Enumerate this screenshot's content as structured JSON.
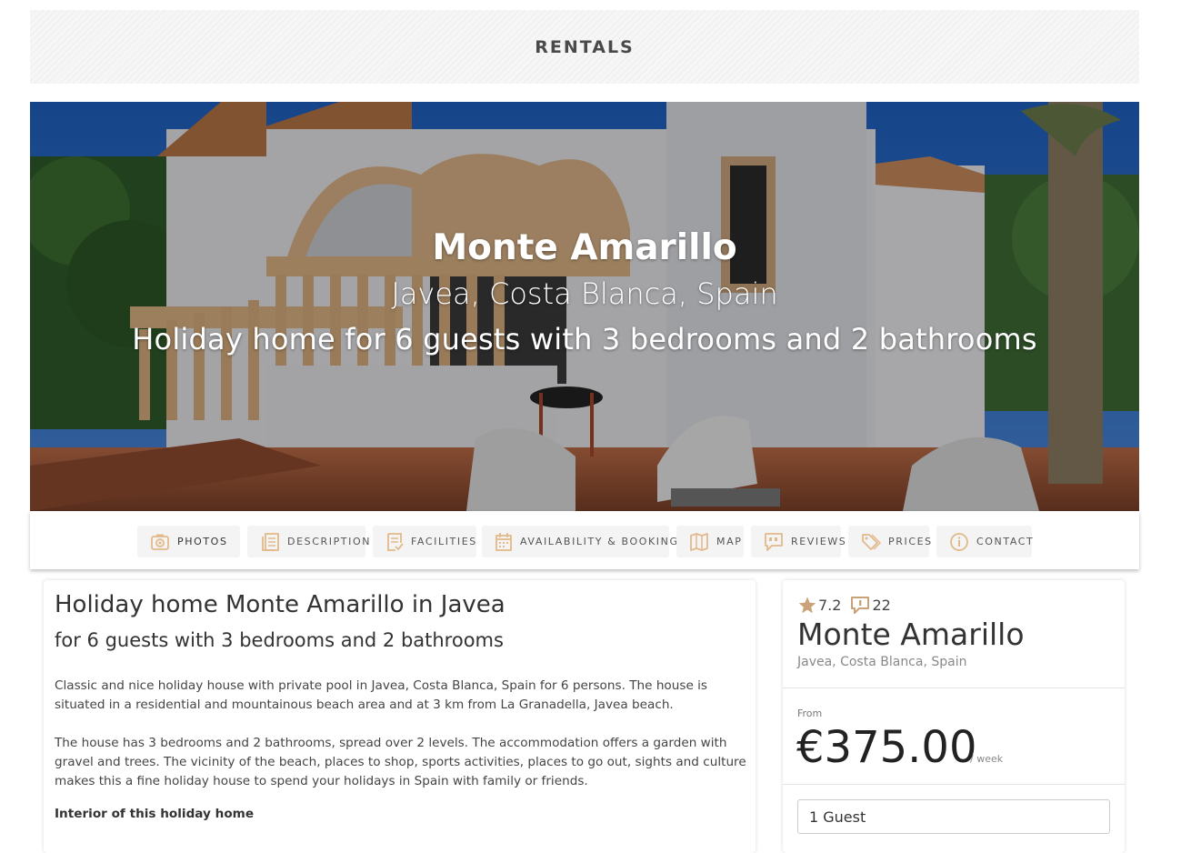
{
  "header": {
    "title": "RENTALS"
  },
  "hero": {
    "name": "Monte Amarillo",
    "location": "Javea, Costa Blanca, Spain",
    "subtitle": "Holiday home for 6 guests with 3 bedrooms and 2 bathrooms"
  },
  "tabs": [
    {
      "label": "PHOTOS",
      "icon": "camera-icon"
    },
    {
      "label": "DESCRIPTION",
      "icon": "document-icon"
    },
    {
      "label": "FACILITIES",
      "icon": "checklist-icon"
    },
    {
      "label": "AVAILABILITY & BOOKING",
      "icon": "calendar-icon"
    },
    {
      "label": "MAP",
      "icon": "map-icon"
    },
    {
      "label": "REVIEWS",
      "icon": "quote-bubble-icon"
    },
    {
      "label": "PRICES",
      "icon": "tags-icon"
    },
    {
      "label": "CONTACT",
      "icon": "info-icon"
    }
  ],
  "description": {
    "heading": "Holiday home Monte Amarillo in Javea",
    "subheading": "for 6 guests with 3 bedrooms and 2 bathrooms",
    "paragraph1": "Classic and nice holiday house with private pool in Javea, Costa Blanca, Spain for 6 persons. The house is situated in a residential and mountainous beach area and at 3 km from La Granadella, Javea beach.",
    "paragraph2": "The house has 3 bedrooms and 2 bathrooms, spread over 2 levels. The accommodation offers a garden with gravel and trees. The vicinity of the beach, places to shop, sports activities, places to go out, sights and culture makes this a fine holiday house to spend your holidays in Spain with family or friends.",
    "interior_heading": "Interior of this holiday home"
  },
  "booking": {
    "rating": "7.2",
    "review_count": "22",
    "name": "Monte Amarillo",
    "location": "Javea, Costa Blanca, Spain",
    "from_label": "From",
    "price": "€375.00",
    "per": "/ week",
    "guests": "1 Guest"
  },
  "colors": {
    "accent": "#e2b98a",
    "tab_bg": "#f4f4f4"
  }
}
